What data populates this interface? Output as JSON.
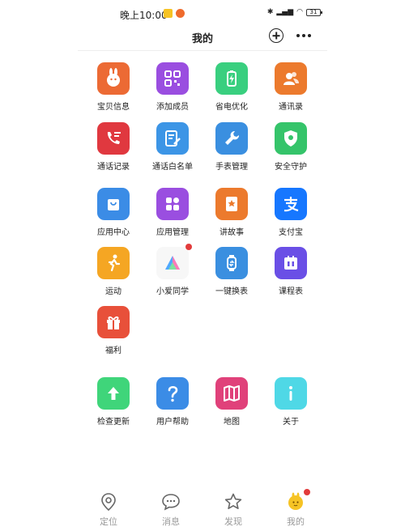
{
  "status_bar": {
    "time": "晚上10:00",
    "battery": "31"
  },
  "header": {
    "title": "我的"
  },
  "tiles": [
    {
      "label": "宝贝信息",
      "color": "#ec6a34",
      "icon": "rabbit-icon"
    },
    {
      "label": "添加成员",
      "color": "#9a4ee0",
      "icon": "qr-code-icon"
    },
    {
      "label": "省电优化",
      "color": "#39cf7f",
      "icon": "battery-saver-icon"
    },
    {
      "label": "通讯录",
      "color": "#ec7a2d",
      "icon": "contacts-icon"
    },
    {
      "label": "通话记录",
      "color": "#e0383f",
      "icon": "call-log-icon"
    },
    {
      "label": "通话白名单",
      "color": "#3c95e6",
      "icon": "whitelist-icon"
    },
    {
      "label": "手表管理",
      "color": "#3a8fe0",
      "icon": "wrench-icon"
    },
    {
      "label": "安全守护",
      "color": "#35c46a",
      "icon": "shield-icon"
    },
    {
      "label": "应用中心",
      "color": "#3b8ce6",
      "icon": "shopping-bag-icon"
    },
    {
      "label": "应用管理",
      "color": "#9a4ee0",
      "icon": "app-grid-icon"
    },
    {
      "label": "讲故事",
      "color": "#ec7a2d",
      "icon": "storybook-icon"
    },
    {
      "label": "支付宝",
      "color": "#1677ff",
      "icon": "alipay-icon"
    },
    {
      "label": "运动",
      "color": "#f5a623",
      "icon": "running-icon"
    },
    {
      "label": "小爱同学",
      "color": "#f7f7f7",
      "icon": "xiaoai-icon"
    },
    {
      "label": "一键换表",
      "color": "#3a8fe0",
      "icon": "watch-swap-icon"
    },
    {
      "label": "课程表",
      "color": "#6a4fe6",
      "icon": "timetable-icon"
    },
    {
      "label": "福利",
      "color": "#e8503a",
      "icon": "gift-icon"
    },
    {
      "label": "检查更新",
      "color": "#3fd57a",
      "icon": "arrow-up-icon"
    },
    {
      "label": "用户帮助",
      "color": "#3b8ce6",
      "icon": "question-icon"
    },
    {
      "label": "地图",
      "color": "#e0417a",
      "icon": "map-icon"
    },
    {
      "label": "关于",
      "color": "#4fd8e6",
      "icon": "info-icon"
    }
  ],
  "tabs": [
    {
      "label": "定位",
      "icon": "location-pin-icon"
    },
    {
      "label": "消息",
      "icon": "message-icon"
    },
    {
      "label": "发现",
      "icon": "star-icon"
    },
    {
      "label": "我的",
      "icon": "profile-avatar-icon"
    }
  ]
}
